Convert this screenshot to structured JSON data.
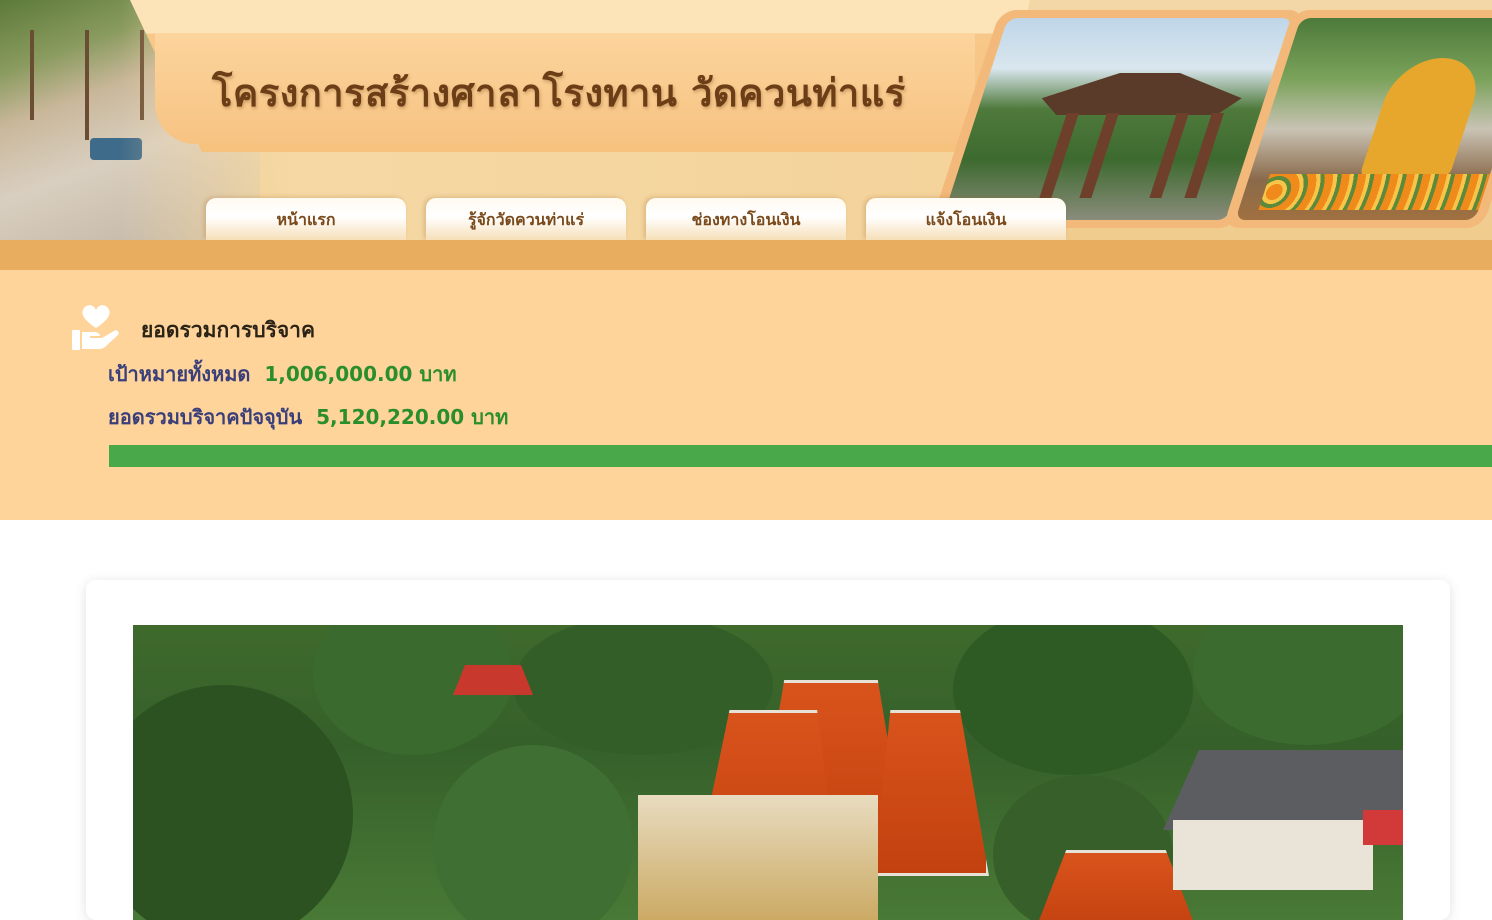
{
  "header": {
    "title": "โครงการสร้างศาลาโรงทาน  วัดควนท่าแร่",
    "nav": [
      {
        "label": "หน้าแรก"
      },
      {
        "label": "รู้จักวัดควนท่าแร่"
      },
      {
        "label": "ช่องทางโอนเงิน"
      },
      {
        "label": "แจ้งโอนเงิน"
      }
    ]
  },
  "donation": {
    "icon": "heart-hand-icon",
    "title": "ยอดรวมการบริจาค",
    "goal_label": "เป้าหมายทั้งหมด",
    "goal_value": "1,006,000.00 บาท",
    "total_label": "ยอดรวมบริจาคปัจจุบัน",
    "total_value": "5,120,220.00 บาท",
    "progress_percent": 100
  },
  "colors": {
    "header_band": "#e8ad5e",
    "summary_background": "#fed49b",
    "progress_fill": "#48a84a",
    "title_text": "#6b3e17",
    "label_text": "#3a3f7a",
    "value_text": "#2a8e2c"
  }
}
